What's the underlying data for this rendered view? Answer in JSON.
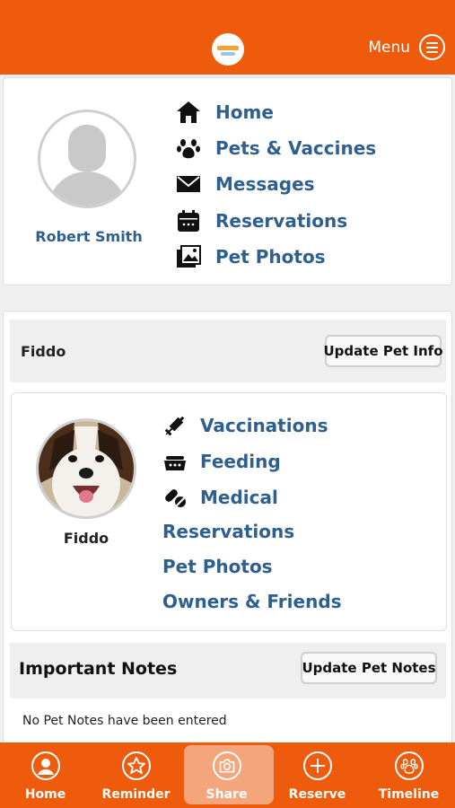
{
  "header": {
    "menu_label": "Menu"
  },
  "profile": {
    "name": "Robert Smith"
  },
  "main_nav": [
    {
      "label": "Home",
      "icon": "home-icon"
    },
    {
      "label": "Pets & Vaccines",
      "icon": "paw-icon"
    },
    {
      "label": "Messages",
      "icon": "envelope-icon"
    },
    {
      "label": "Reservations",
      "icon": "calendar-icon"
    },
    {
      "label": "Pet Photos",
      "icon": "photos-icon"
    }
  ],
  "pet": {
    "name": "Fiddo",
    "update_button": "Update Pet Info",
    "nav": [
      {
        "label": "Vaccinations",
        "icon": "syringe-icon"
      },
      {
        "label": "Feeding",
        "icon": "food-bowl-icon"
      },
      {
        "label": "Medical",
        "icon": "pills-icon"
      },
      {
        "label": "Reservations"
      },
      {
        "label": "Pet Photos"
      },
      {
        "label": "Owners & Friends"
      }
    ]
  },
  "notes": {
    "title": "Important Notes",
    "update_button": "Update Pet Notes",
    "empty_text": "No Pet Notes have been entered"
  },
  "tabbar": [
    {
      "label": "Home",
      "icon": "user-circle-icon"
    },
    {
      "label": "Reminder",
      "icon": "star-icon"
    },
    {
      "label": "Share",
      "icon": "camera-icon",
      "active": true
    },
    {
      "label": "Reserve",
      "icon": "plus-icon"
    },
    {
      "label": "Timeline",
      "icon": "paw-icon"
    }
  ],
  "colors": {
    "brand": "#ef5b0c",
    "link": "#2f5f8f",
    "active_tab": "#f5a57c"
  }
}
